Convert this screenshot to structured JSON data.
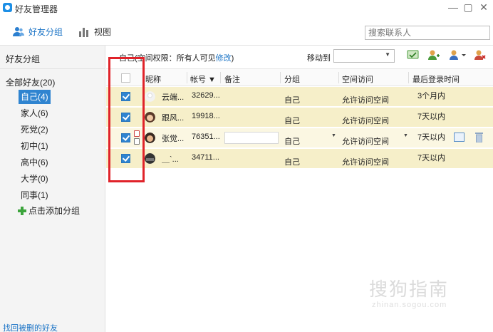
{
  "window": {
    "title": "好友管理器",
    "controls": [
      "—",
      "▢",
      "✕"
    ]
  },
  "toolbar": {
    "friends_group": "好友分组",
    "view": "视图",
    "search_placeholder": "搜索联系人"
  },
  "sidebar": {
    "header": "好友分组",
    "all_friends": "全部好友(20)",
    "groups": [
      {
        "label": "自己(4)",
        "selected": true
      },
      {
        "label": "家人(6)",
        "selected": false
      },
      {
        "label": "死党(2)",
        "selected": false
      },
      {
        "label": "初中(1)",
        "selected": false
      },
      {
        "label": "高中(6)",
        "selected": false
      },
      {
        "label": "大学(0)",
        "selected": false
      },
      {
        "label": "同事(1)",
        "selected": false
      }
    ],
    "add_group": "点击添加分组",
    "recover": "找回被删的好友"
  },
  "main": {
    "perm_prefix": "自己(空间权限：所有人可见",
    "perm_link": "修改",
    "perm_suffix": ")",
    "move_to": "移动到"
  },
  "table": {
    "headers": {
      "name": "昵称",
      "account": "帐号 ▼",
      "note": "备注",
      "group": "分组",
      "space": "空间访问",
      "last_login": "最后登录时间"
    },
    "rows": [
      {
        "name": "云端...",
        "account": "32629...",
        "group": "自己",
        "space": "允许访问空间",
        "last_login": "3个月内",
        "checked": true
      },
      {
        "name": "跟风...",
        "account": "19918...",
        "group": "自己",
        "space": "允许访问空间",
        "last_login": "7天以内",
        "checked": true
      },
      {
        "name": "张觉...",
        "account": "76351...",
        "group": "自己",
        "space": "允许访问空间",
        "last_login": "7天以内",
        "checked": true
      },
      {
        "name": "＿ˋ...",
        "account": "34711...",
        "group": "自己",
        "space": "允许访问空间",
        "last_login": "7天以内",
        "checked": true
      }
    ]
  },
  "colors": {
    "accent": "#2f84d0",
    "row_highlight": "#f6efc9",
    "annotation_red": "#e0232a"
  },
  "watermark": {
    "text": "搜狗指南",
    "url": "zhinan.sogou.com"
  }
}
